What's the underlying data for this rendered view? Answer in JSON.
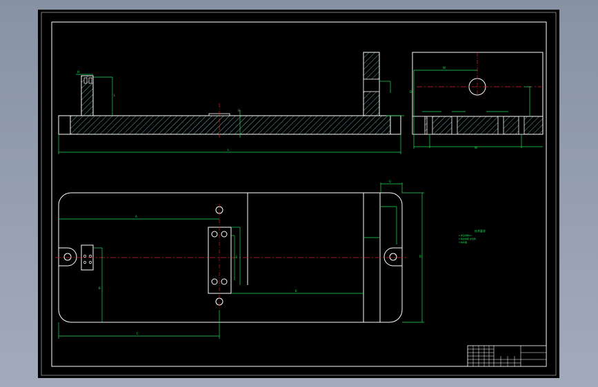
{
  "drawing": {
    "background": "#000000",
    "colors": {
      "outline": "#ffffff",
      "dimension": "#22e05a",
      "centerline": "#e02020",
      "hatch": "#6fb0ae",
      "viewport": "#8d97a8"
    },
    "views": [
      "front-section-view",
      "side-section-view",
      "top-plan-view"
    ],
    "dimension_labels": {
      "front_height": "H",
      "front_width": "L",
      "front_length": "L",
      "front_mid": "H",
      "side_top": "W",
      "side_mid": "D",
      "side_depth": "W",
      "plan_top_offset": "A",
      "plan_width": "B",
      "plan_bottom": "C",
      "plan_right": "D",
      "plan_mid": "E",
      "plan_left": "F",
      "plan_right_top": "G"
    },
    "notes_heading": "技术要求",
    "notes": [
      "1.未注倒角C1.",
      "2.锐边倒钝,去毛刺.",
      "3.热处理."
    ],
    "title_block": {
      "cells": [
        "",
        "",
        "",
        "",
        "",
        ""
      ]
    }
  }
}
